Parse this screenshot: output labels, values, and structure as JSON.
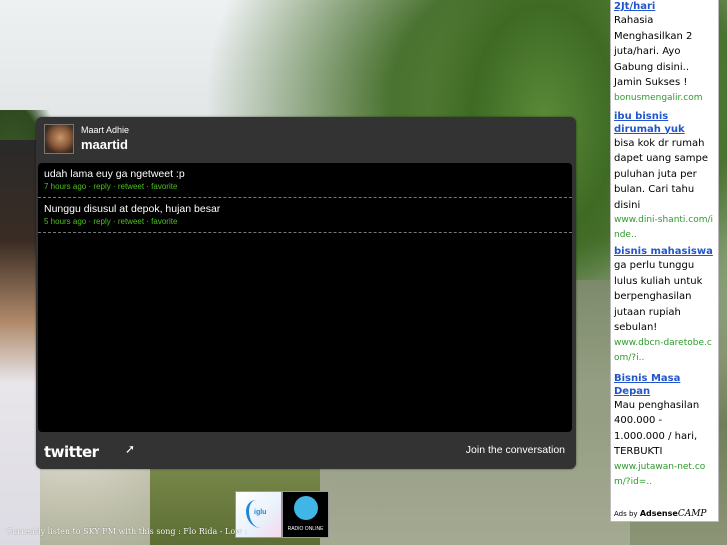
{
  "twitter": {
    "real_name": "Maart Adhie",
    "screen_name": "maartid",
    "tweets": [
      {
        "text": "udah lama euy ga ngetweet :p",
        "time": "7 hours ago",
        "reply": "reply",
        "retweet": "retweet",
        "favorite": "favorite"
      },
      {
        "text": "Nunggu disusul at depok, hujan besar",
        "time": "5 hours ago",
        "reply": "reply",
        "retweet": "retweet",
        "favorite": "favorite"
      }
    ],
    "logo": "twitter",
    "join": "Join the conversation"
  },
  "ads": {
    "items": [
      {
        "title": "2Jt/hari",
        "desc": "Rahasia Menghasilkan 2 juta/hari. Ayo Gabung disini.. Jamin Sukses !",
        "url": "bonusmengalir.com"
      },
      {
        "title": "ibu bisnis dirumah yuk",
        "desc": "bisa kok dr rumah dapet uang sampe puluhan juta per bulan. Cari tahu disini",
        "url": "www.dini-shanti.com/inde.."
      },
      {
        "title": "bisnis mahasiswa",
        "desc": "ga perlu tunggu lulus kuliah untuk berpenghasilan jutaan rupiah sebulan!",
        "url": "www.dbcn-daretobe.com/?i.."
      },
      {
        "title": "Bisnis Masa Depan",
        "desc": "Mau penghasilan 400.000 - 1.000.000 / hari, TERBUKTI",
        "url": "www.jutawan-net.com/?id=.."
      }
    ],
    "footer_prefix": "Ads by",
    "footer_brand": "Adsense",
    "footer_camp": "CAMP"
  },
  "badges": {
    "badge1_text": "iglu",
    "badge2_text": "RADIO ONLINE"
  },
  "status_text": "Currently listen to SKY FM with this song : Flo Rida - Low :"
}
